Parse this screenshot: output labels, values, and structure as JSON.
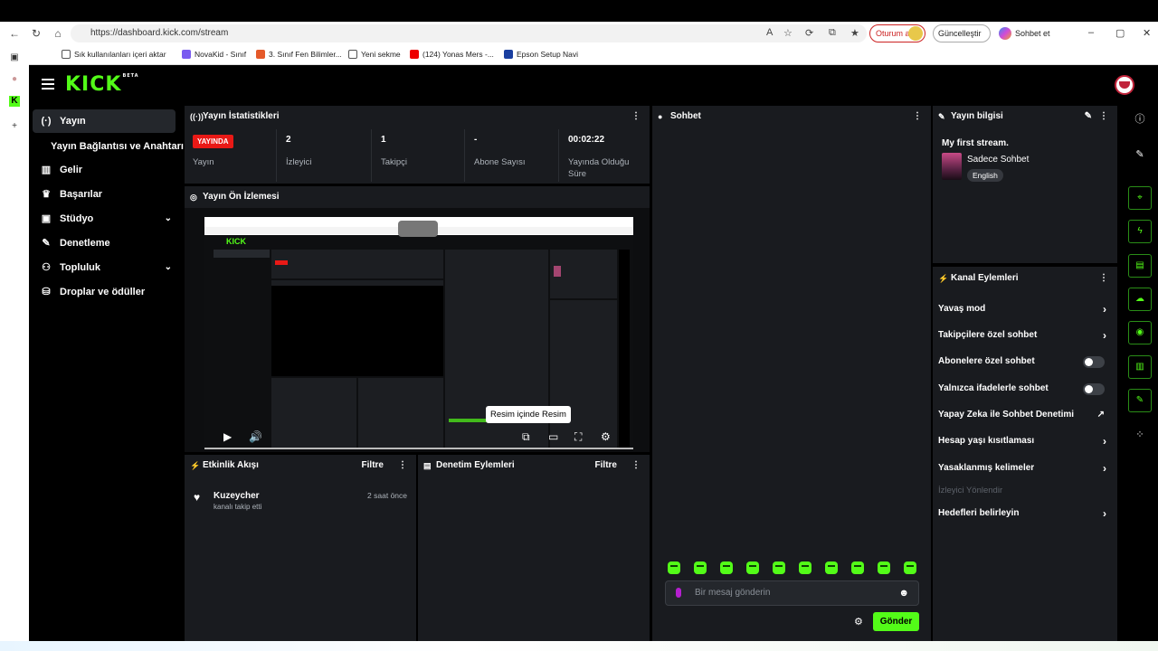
{
  "browser": {
    "url": "https://dashboard.kick.com/stream",
    "login_label": "Oturum aç",
    "update_label": "Güncelleştir ⋯",
    "chat_label": "Sohbet et",
    "bookmarks": [
      "Sık kullanılanları içeri aktar",
      "NovaKid - Sınıf",
      "3. Sınıf Fen Bilimler...",
      "Yeni sekme",
      "(124) Yonas Mers -...",
      "Epson Setup Navi"
    ]
  },
  "app": {
    "logo": "KICK",
    "logo_badge": "BETA"
  },
  "sidebar": {
    "items": [
      {
        "label": "Yayın",
        "icon": "broadcast-icon"
      },
      {
        "label": "Yayın Bağlantısı ve Anahtarı"
      },
      {
        "label": "Gelir",
        "icon": "chart-icon"
      },
      {
        "label": "Başarılar",
        "icon": "trophy-icon"
      },
      {
        "label": "Stüdyo",
        "icon": "studio-icon"
      },
      {
        "label": "Denetleme",
        "icon": "wrench-icon"
      },
      {
        "label": "Topluluk",
        "icon": "community-icon"
      },
      {
        "label": "Droplar ve ödüller",
        "icon": "drops-icon"
      }
    ]
  },
  "stats": {
    "title": "Yayın İstatistikleri",
    "live_badge": "YAYINDA",
    "items": [
      {
        "value": "",
        "label": "Yayın"
      },
      {
        "value": "2",
        "label": "İzleyici"
      },
      {
        "value": "1",
        "label": "Takipçi"
      },
      {
        "value": "-",
        "label": "Abone Sayısı"
      },
      {
        "value": "00:02:22",
        "label": "Yayında Olduğu Süre"
      }
    ]
  },
  "preview": {
    "title": "Yayın Ön İzlemesi",
    "tooltip": "Resim içinde Resim"
  },
  "activity": {
    "title": "Etkinlik Akışı",
    "filter": "Filtre",
    "events": [
      {
        "name": "Kuzeycher",
        "desc": "kanalı takip etti",
        "time": "2 saat önce"
      }
    ]
  },
  "moderation": {
    "title": "Denetim Eylemleri",
    "filter": "Filtre"
  },
  "chat": {
    "title": "Sohbet",
    "placeholder": "Bir mesaj gönderin",
    "send": "Gönder"
  },
  "stream_info": {
    "title": "Yayın bilgisi",
    "stream_title": "My first stream.",
    "category": "Sadece Sohbet",
    "language": "English"
  },
  "channel_actions": {
    "title": "Kanal Eylemleri",
    "items": [
      {
        "label": "Yavaş mod",
        "control": "chevron"
      },
      {
        "label": "Takipçilere özel sohbet",
        "control": "chevron"
      },
      {
        "label": "Abonelere özel sohbet",
        "control": "toggle"
      },
      {
        "label": "Yalnızca ifadelerle sohbet",
        "control": "toggle"
      },
      {
        "label": "Yapay Zeka ile Sohbet Denetimi",
        "control": "external"
      },
      {
        "label": "Hesap yaşı kısıtlaması",
        "control": "chevron"
      },
      {
        "label": "Yasaklanmış kelimeler",
        "control": "chevron"
      },
      {
        "label": "İzleyici Yönlendir",
        "control": "none"
      },
      {
        "label": "Hedefleri belirleyin",
        "control": "chevron"
      }
    ]
  },
  "colors": {
    "accent": "#53fc18",
    "live": "#e91916",
    "panel": "#191b1f"
  }
}
